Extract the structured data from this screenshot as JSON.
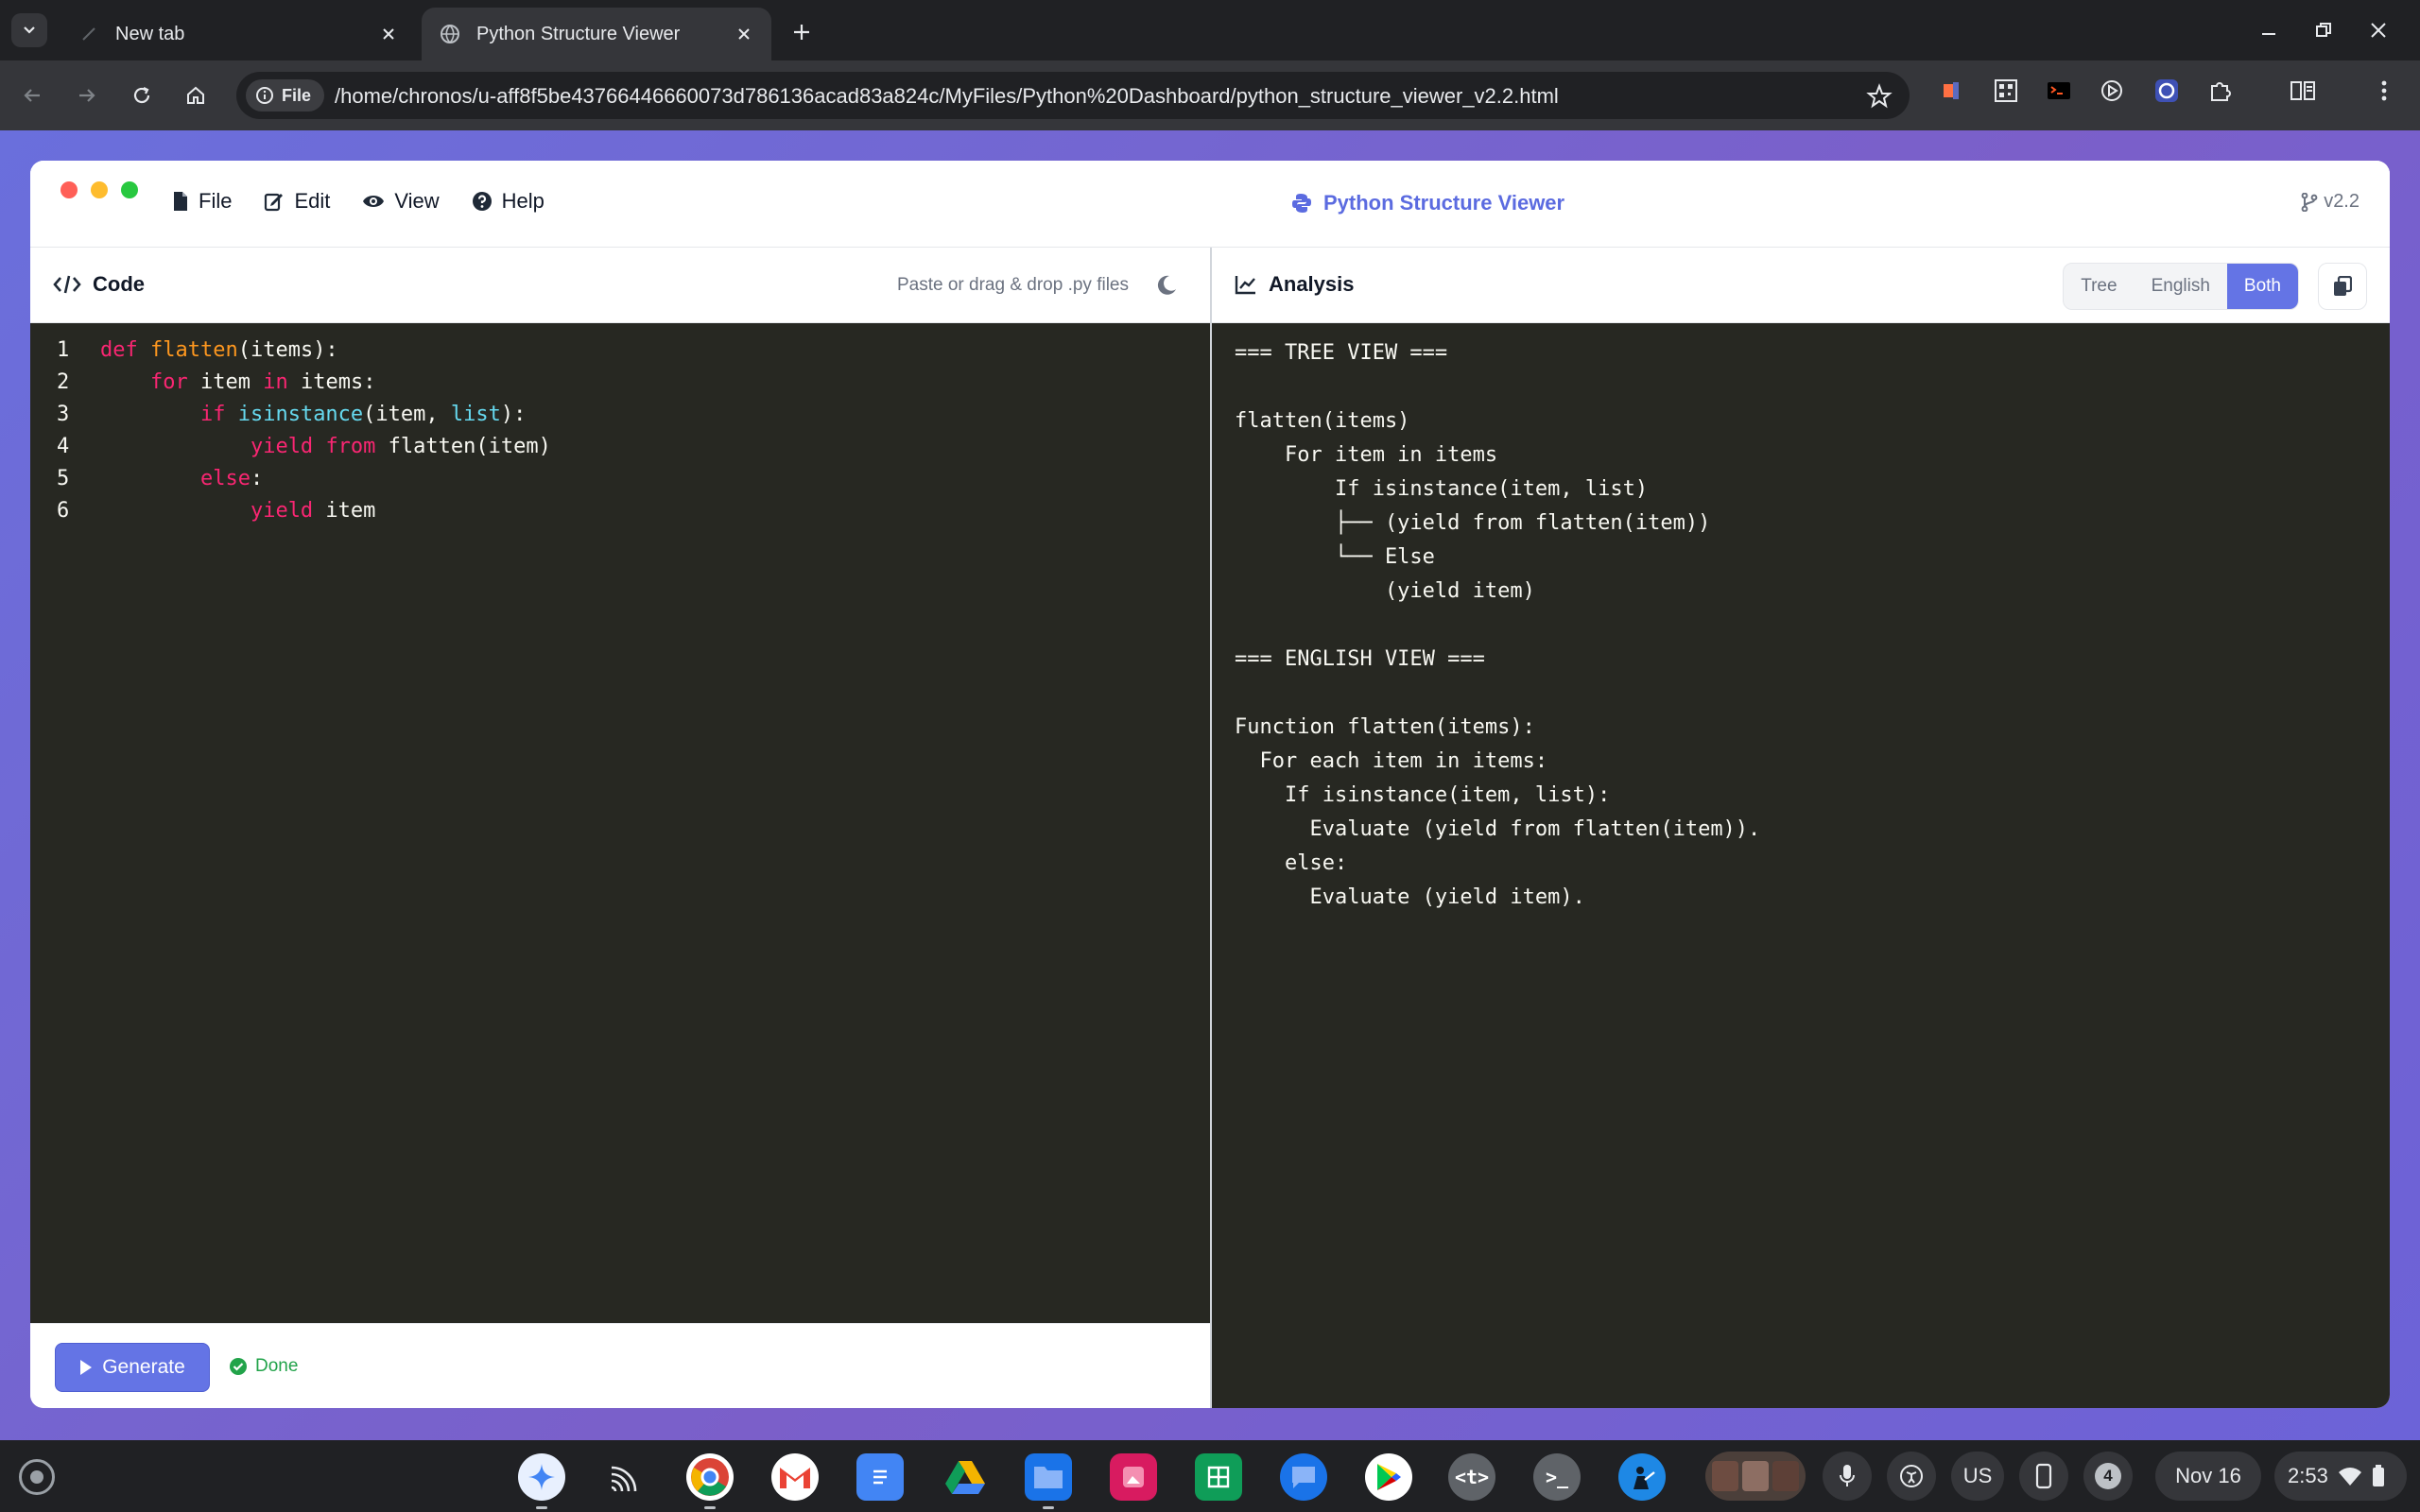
{
  "browser": {
    "tabs": [
      {
        "title": "New tab",
        "active": false
      },
      {
        "title": "Python Structure Viewer",
        "active": true
      }
    ],
    "omnibox": {
      "chip_label": "File",
      "url": "/home/chronos/u-aff8f5be43766446660073d786136acad83a824c/MyFiles/Python%20Dashboard/python_structure_viewer_v2.2.html"
    }
  },
  "app": {
    "title": "Python Structure Viewer",
    "version": "v2.2",
    "menu": [
      "File",
      "Edit",
      "View",
      "Help"
    ],
    "code_pane": {
      "title": "Code",
      "hint": "Paste or drag & drop .py files",
      "lines": [
        {
          "num": "1",
          "tokens": [
            {
              "t": "def",
              "c": "kw"
            },
            {
              "t": " "
            },
            {
              "t": "flatten",
              "c": "fn"
            },
            {
              "t": "(items):"
            }
          ]
        },
        {
          "num": "2",
          "tokens": [
            {
              "t": "    "
            },
            {
              "t": "for",
              "c": "kw"
            },
            {
              "t": " item "
            },
            {
              "t": "in",
              "c": "kw"
            },
            {
              "t": " items:"
            }
          ]
        },
        {
          "num": "3",
          "tokens": [
            {
              "t": "        "
            },
            {
              "t": "if",
              "c": "kw"
            },
            {
              "t": " "
            },
            {
              "t": "isinstance",
              "c": "bi"
            },
            {
              "t": "(item, "
            },
            {
              "t": "list",
              "c": "bi"
            },
            {
              "t": "):"
            }
          ]
        },
        {
          "num": "4",
          "tokens": [
            {
              "t": "            "
            },
            {
              "t": "yield",
              "c": "kw"
            },
            {
              "t": " "
            },
            {
              "t": "from",
              "c": "kw"
            },
            {
              "t": " flatten(item)"
            }
          ]
        },
        {
          "num": "5",
          "tokens": [
            {
              "t": "        "
            },
            {
              "t": "else",
              "c": "kw"
            },
            {
              "t": ":"
            }
          ]
        },
        {
          "num": "6",
          "tokens": [
            {
              "t": "            "
            },
            {
              "t": "yield",
              "c": "kw"
            },
            {
              "t": " item"
            }
          ]
        }
      ],
      "generate_label": "Generate",
      "status": "Done"
    },
    "analysis_pane": {
      "title": "Analysis",
      "modes": [
        "Tree",
        "English",
        "Both"
      ],
      "active_mode": "Both",
      "output_lines": [
        "=== TREE VIEW ===",
        "",
        "flatten(items)",
        "    For item in items",
        "        If isinstance(item, list)",
        "        ├── (yield from flatten(item))",
        "        └── Else",
        "            (yield item)",
        "",
        "=== ENGLISH VIEW ===",
        "",
        "Function flatten(items):",
        "  For each item in items:",
        "    If isinstance(item, list):",
        "      Evaluate (yield from flatten(item)).",
        "    else:",
        "      Evaluate (yield item)."
      ]
    }
  },
  "shelf": {
    "tray": {
      "ime": "US",
      "notifications": "4",
      "date": "Nov 16",
      "time": "2:53"
    }
  },
  "colors": {
    "accent": "#6474e5",
    "editor_bg": "#272822",
    "keyword": "#f92672",
    "function": "#fd971f",
    "builtin": "#66d9ef"
  }
}
